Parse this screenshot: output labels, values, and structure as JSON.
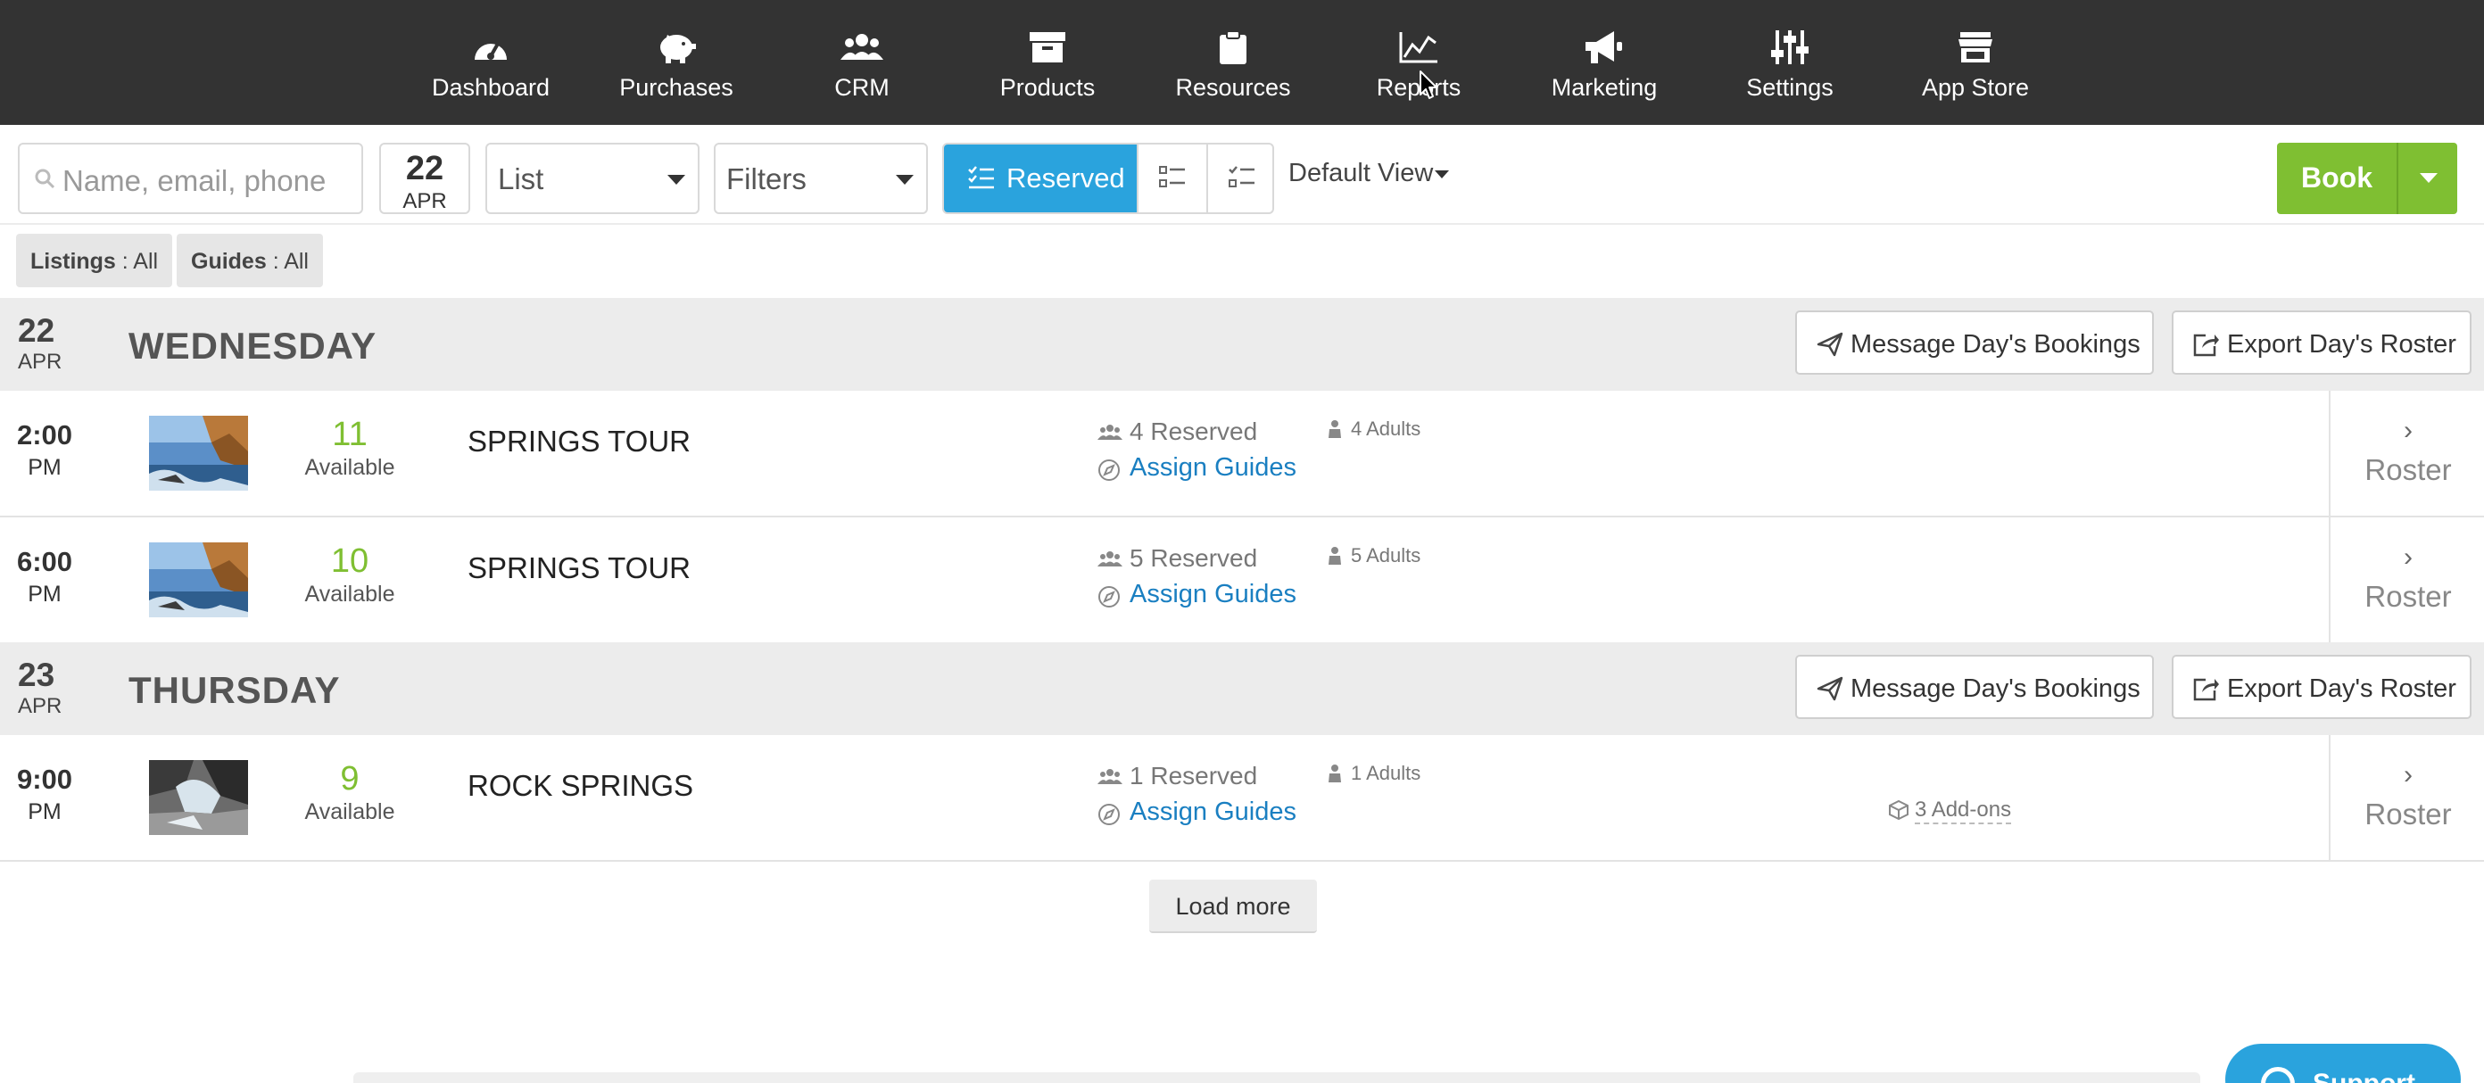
{
  "nav": {
    "items": [
      {
        "label": "Dashboard",
        "icon": "dashboard-gauge-icon"
      },
      {
        "label": "Purchases",
        "icon": "piggy-bank-icon"
      },
      {
        "label": "CRM",
        "icon": "users-icon"
      },
      {
        "label": "Products",
        "icon": "archive-box-icon"
      },
      {
        "label": "Resources",
        "icon": "clipboard-icon"
      },
      {
        "label": "Reports",
        "icon": "line-chart-icon"
      },
      {
        "label": "Marketing",
        "icon": "megaphone-icon"
      },
      {
        "label": "Settings",
        "icon": "sliders-icon"
      },
      {
        "label": "App Store",
        "icon": "store-icon"
      }
    ]
  },
  "toolbar": {
    "search_placeholder": "Name, email, phone",
    "date": {
      "day": "22",
      "month": "APR"
    },
    "view_select": "List",
    "filters_select": "Filters",
    "reserved_label": "Reserved",
    "default_view": "Default View",
    "book_label": "Book"
  },
  "chips": [
    {
      "key": "Listings",
      "value": " : All"
    },
    {
      "key": "Guides",
      "value": " : All"
    }
  ],
  "days": [
    {
      "day": "22",
      "month": "APR",
      "name": "WEDNESDAY",
      "message_label": "Message Day's Bookings",
      "export_label": "Export Day's Roster",
      "rows": [
        {
          "time": "2:00",
          "ampm": "PM",
          "available": "11",
          "available_label": "Available",
          "tour": "SPRINGS TOUR",
          "reserved": "4 Reserved",
          "assign": "Assign Guides",
          "adults": "4 Adults",
          "roster": "Roster"
        },
        {
          "time": "6:00",
          "ampm": "PM",
          "available": "10",
          "available_label": "Available",
          "tour": "SPRINGS TOUR",
          "reserved": "5 Reserved",
          "assign": "Assign Guides",
          "adults": "5 Adults",
          "roster": "Roster"
        }
      ]
    },
    {
      "day": "23",
      "month": "APR",
      "name": "THURSDAY",
      "message_label": "Message Day's Bookings",
      "export_label": "Export Day's Roster",
      "rows": [
        {
          "time": "9:00",
          "ampm": "PM",
          "available": "9",
          "available_label": "Available",
          "tour": "ROCK SPRINGS",
          "reserved": "1 Reserved",
          "assign": "Assign Guides",
          "adults": "1 Adults",
          "addons": "3 Add-ons",
          "roster": "Roster"
        }
      ]
    }
  ],
  "load_more": "Load more",
  "support_label": "Support",
  "colors": {
    "nav_bg": "#333333",
    "accent_blue": "#2aa3dd",
    "book_green": "#7fbf32",
    "link_blue": "#1a7fc1",
    "day_header_bg": "#ececec"
  }
}
